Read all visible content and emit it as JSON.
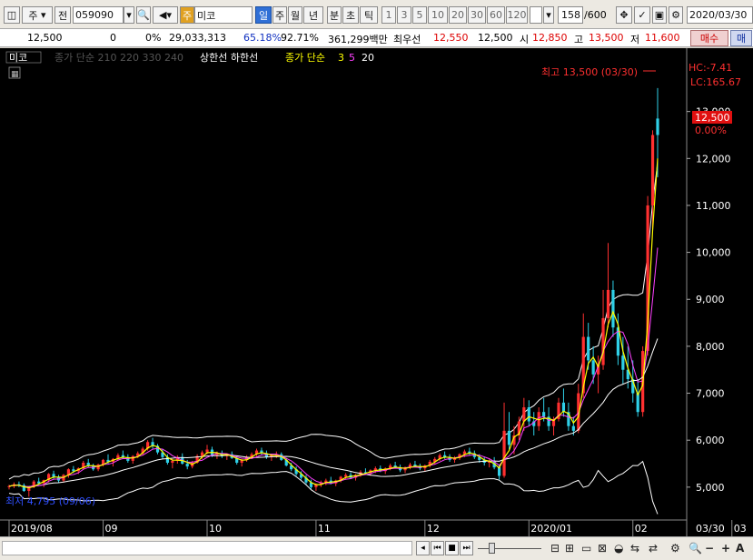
{
  "toolbar": {
    "type_select": "주",
    "jeon": "전",
    "code": "059090",
    "badge": "주",
    "name": "미코",
    "periods": [
      "일",
      "주",
      "월",
      "년",
      "분",
      "초",
      "틱"
    ],
    "numbers": [
      "1",
      "3",
      "5",
      "10",
      "20",
      "30",
      "60",
      "120"
    ],
    "count": "158",
    "max": "/600",
    "date": "2020/03/30"
  },
  "info": {
    "price": "12,500",
    "change": "0",
    "change_pct": "0%",
    "volume": "29,033,313",
    "rate1": "65.18%",
    "rate2": "92.71%",
    "amount": "361,299백만",
    "pref_label": "최우선",
    "pref_val": "12,550",
    "pref_val2": "12,500",
    "open_label": "시",
    "open_val": "12,850",
    "high_label": "고",
    "high_val": "13,500",
    "low_label": "저",
    "low_val": "11,600",
    "buy": "매수",
    "sell": "매"
  },
  "chart": {
    "legend_name": "미코",
    "legend_ma_dim": "종가 단순 210 220 330 240",
    "legend_bands": "상한선  하한선",
    "legend_ma_label": "종가 단순",
    "legend_ma3": "3",
    "legend_ma5": "5",
    "legend_ma20": "20",
    "high_note": "최고 13,500 (03/30)",
    "low_note": "최저 4,795 (09/06)",
    "lc": "LC:165.67",
    "hc": "HC:-7.41",
    "price_tag": "12,500",
    "pct_tag": "0.00%",
    "colors": {
      "up": "#ff3030",
      "down": "#2fd0e8",
      "ma3": "#ffff00",
      "ma5": "#ff40ff",
      "ma20": "#ffffff",
      "band": "#ffffff",
      "tag": "#e01010"
    }
  },
  "chart_data": {
    "type": "candlestick",
    "y_ticks": [
      "13,000",
      "12,000",
      "11,000",
      "10,000",
      "9,000",
      "8,000",
      "7,000",
      "6,000",
      "5,000"
    ],
    "ylim": [
      4300,
      14000
    ],
    "x_ticks": [
      "2019/08",
      "09",
      "10",
      "11",
      "12",
      "2020/01",
      "02",
      "03",
      "03/30"
    ],
    "candles": [
      [
        5000,
        5050,
        4950,
        5020
      ],
      [
        5020,
        5100,
        4980,
        5060
      ],
      [
        5060,
        5120,
        5000,
        5040
      ],
      [
        5040,
        5080,
        4900,
        4920
      ],
      [
        4920,
        5020,
        4795,
        5000
      ],
      [
        5000,
        5150,
        4980,
        5120
      ],
      [
        5120,
        5200,
        5050,
        5080
      ],
      [
        5080,
        5160,
        5000,
        5150
      ],
      [
        5150,
        5300,
        5100,
        5280
      ],
      [
        5280,
        5350,
        5180,
        5220
      ],
      [
        5220,
        5260,
        5100,
        5140
      ],
      [
        5140,
        5280,
        5100,
        5260
      ],
      [
        5260,
        5400,
        5200,
        5380
      ],
      [
        5380,
        5450,
        5300,
        5340
      ],
      [
        5340,
        5420,
        5280,
        5400
      ],
      [
        5400,
        5560,
        5380,
        5520
      ],
      [
        5520,
        5600,
        5420,
        5460
      ],
      [
        5460,
        5500,
        5350,
        5380
      ],
      [
        5380,
        5500,
        5340,
        5480
      ],
      [
        5480,
        5600,
        5440,
        5580
      ],
      [
        5580,
        5700,
        5500,
        5540
      ],
      [
        5540,
        5620,
        5440,
        5600
      ],
      [
        5600,
        5720,
        5560,
        5680
      ],
      [
        5680,
        5780,
        5600,
        5640
      ],
      [
        5640,
        5700,
        5520,
        5560
      ],
      [
        5560,
        5680,
        5500,
        5660
      ],
      [
        5660,
        5760,
        5620,
        5720
      ],
      [
        5720,
        5860,
        5680,
        5820
      ],
      [
        5820,
        6000,
        5780,
        5960
      ],
      [
        5960,
        6050,
        5820,
        5880
      ],
      [
        5880,
        5920,
        5700,
        5740
      ],
      [
        5740,
        5820,
        5600,
        5640
      ],
      [
        5640,
        5700,
        5480,
        5520
      ],
      [
        5520,
        5600,
        5400,
        5560
      ],
      [
        5560,
        5680,
        5500,
        5640
      ],
      [
        5640,
        5720,
        5480,
        5500
      ],
      [
        5500,
        5580,
        5380,
        5440
      ],
      [
        5440,
        5560,
        5400,
        5520
      ],
      [
        5520,
        5700,
        5500,
        5660
      ],
      [
        5660,
        5780,
        5600,
        5740
      ],
      [
        5740,
        5900,
        5700,
        5800
      ],
      [
        5800,
        5860,
        5640,
        5680
      ],
      [
        5680,
        5760,
        5600,
        5720
      ],
      [
        5720,
        5780,
        5620,
        5660
      ],
      [
        5660,
        5720,
        5580,
        5700
      ],
      [
        5700,
        5760,
        5600,
        5620
      ],
      [
        5620,
        5660,
        5480,
        5520
      ],
      [
        5520,
        5600,
        5440,
        5580
      ],
      [
        5580,
        5680,
        5540,
        5640
      ],
      [
        5640,
        5740,
        5600,
        5700
      ],
      [
        5700,
        5820,
        5660,
        5780
      ],
      [
        5780,
        5840,
        5680,
        5720
      ],
      [
        5720,
        5780,
        5600,
        5640
      ],
      [
        5640,
        5700,
        5560,
        5680
      ],
      [
        5680,
        5760,
        5620,
        5700
      ],
      [
        5700,
        5740,
        5560,
        5580
      ],
      [
        5580,
        5620,
        5440,
        5460
      ],
      [
        5460,
        5520,
        5340,
        5380
      ],
      [
        5380,
        5440,
        5240,
        5280
      ],
      [
        5280,
        5340,
        5160,
        5200
      ],
      [
        5200,
        5260,
        5060,
        5100
      ],
      [
        5100,
        5160,
        4960,
        5000
      ],
      [
        5000,
        5080,
        4920,
        5060
      ],
      [
        5060,
        5140,
        5000,
        5100
      ],
      [
        5100,
        5180,
        5040,
        5140
      ],
      [
        5140,
        5220,
        5060,
        5080
      ],
      [
        5080,
        5160,
        5020,
        5140
      ],
      [
        5140,
        5240,
        5100,
        5220
      ],
      [
        5220,
        5300,
        5160,
        5260
      ],
      [
        5260,
        5320,
        5180,
        5200
      ],
      [
        5200,
        5280,
        5140,
        5260
      ],
      [
        5260,
        5360,
        5220,
        5320
      ],
      [
        5320,
        5400,
        5260,
        5300
      ],
      [
        5300,
        5380,
        5240,
        5360
      ],
      [
        5360,
        5440,
        5300,
        5400
      ],
      [
        5400,
        5460,
        5320,
        5340
      ],
      [
        5340,
        5420,
        5280,
        5400
      ],
      [
        5400,
        5500,
        5360,
        5460
      ],
      [
        5460,
        5540,
        5400,
        5420
      ],
      [
        5420,
        5480,
        5320,
        5360
      ],
      [
        5360,
        5440,
        5300,
        5420
      ],
      [
        5420,
        5520,
        5380,
        5480
      ],
      [
        5480,
        5560,
        5420,
        5440
      ],
      [
        5440,
        5500,
        5360,
        5400
      ],
      [
        5400,
        5480,
        5340,
        5460
      ],
      [
        5460,
        5580,
        5420,
        5540
      ],
      [
        5540,
        5640,
        5480,
        5600
      ],
      [
        5600,
        5720,
        5560,
        5680
      ],
      [
        5680,
        5760,
        5600,
        5640
      ],
      [
        5640,
        5700,
        5540,
        5580
      ],
      [
        5580,
        5660,
        5520,
        5620
      ],
      [
        5620,
        5720,
        5580,
        5700
      ],
      [
        5700,
        5800,
        5640,
        5760
      ],
      [
        5760,
        5840,
        5680,
        5720
      ],
      [
        5720,
        5780,
        5600,
        5640
      ],
      [
        5640,
        5700,
        5520,
        5580
      ],
      [
        5580,
        5640,
        5460,
        5520
      ],
      [
        5520,
        5600,
        5420,
        5560
      ],
      [
        5560,
        5640,
        5380,
        5420
      ],
      [
        5420,
        5480,
        5160,
        5240
      ],
      [
        5240,
        6800,
        5200,
        6200
      ],
      [
        6200,
        6600,
        5800,
        5900
      ],
      [
        5900,
        6300,
        5700,
        6100
      ],
      [
        6100,
        6500,
        6000,
        6400
      ],
      [
        6400,
        6900,
        6200,
        6700
      ],
      [
        6700,
        6850,
        6300,
        6400
      ],
      [
        6400,
        6600,
        6100,
        6300
      ],
      [
        6300,
        6700,
        6200,
        6600
      ],
      [
        6600,
        6900,
        6400,
        6500
      ],
      [
        6500,
        6700,
        6200,
        6300
      ],
      [
        6300,
        6500,
        6100,
        6450
      ],
      [
        6450,
        6900,
        6400,
        6800
      ],
      [
        6800,
        7100,
        6500,
        6600
      ],
      [
        6600,
        6800,
        6200,
        6300
      ],
      [
        6300,
        6500,
        6100,
        6200
      ],
      [
        6200,
        7200,
        6150,
        7000
      ],
      [
        7000,
        8700,
        6900,
        8200
      ],
      [
        8200,
        8500,
        7500,
        7700
      ],
      [
        7700,
        8000,
        7200,
        7400
      ],
      [
        7400,
        7800,
        7000,
        7600
      ],
      [
        7600,
        9200,
        7500,
        8600
      ],
      [
        8600,
        10200,
        8400,
        9200
      ],
      [
        9200,
        9400,
        8200,
        8400
      ],
      [
        8400,
        8700,
        7600,
        7800
      ],
      [
        7800,
        8200,
        7200,
        7500
      ],
      [
        7500,
        8000,
        7100,
        7300
      ],
      [
        7300,
        7700,
        6800,
        7000
      ],
      [
        7000,
        7300,
        6500,
        6600
      ],
      [
        6600,
        8000,
        6500,
        7900
      ],
      [
        7900,
        11200,
        7800,
        11000
      ],
      [
        11000,
        12600,
        10500,
        12500
      ],
      [
        12850,
        13500,
        11600,
        12500
      ]
    ]
  },
  "bottom": {
    "nav": [
      "◂",
      "⏮",
      "■",
      "⏭"
    ],
    "tools": [
      "⊟",
      "⊞",
      "▭",
      "⊠",
      "◒",
      "⇆",
      "⇄",
      "⚙"
    ],
    "zoom_minus": "−",
    "zoom_plus": "+",
    "font": "A"
  }
}
